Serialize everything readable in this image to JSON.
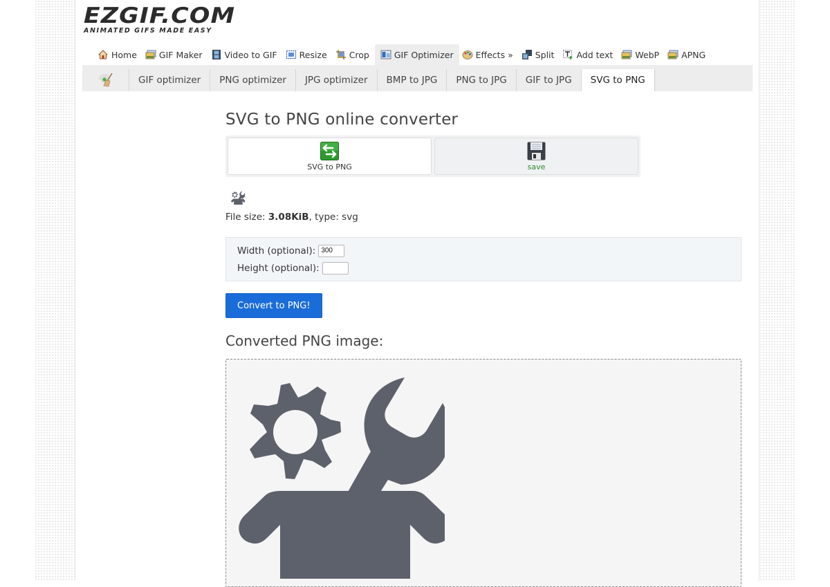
{
  "logo": {
    "main": "EZGIF.COM",
    "tagline": "ANIMATED GIFS MADE EASY"
  },
  "topnav": [
    {
      "label": "Home",
      "icon": "home-icon",
      "active": false
    },
    {
      "label": "GIF Maker",
      "icon": "picture-icon",
      "active": false
    },
    {
      "label": "Video to GIF",
      "icon": "film-icon",
      "active": false
    },
    {
      "label": "Resize",
      "icon": "resize-icon",
      "active": false
    },
    {
      "label": "Crop",
      "icon": "crop-icon",
      "active": false
    },
    {
      "label": "GIF Optimizer",
      "icon": "optimizer-icon",
      "active": true
    },
    {
      "label": "Effects »",
      "icon": "palette-icon",
      "active": false
    },
    {
      "label": "Split",
      "icon": "split-icon",
      "active": false
    },
    {
      "label": "Add text",
      "icon": "add-text-icon",
      "active": false
    },
    {
      "label": "WebP",
      "icon": "picture-icon",
      "active": false
    },
    {
      "label": "APNG",
      "icon": "picture-icon",
      "active": false
    }
  ],
  "subnav": {
    "icon": "broom-icon",
    "tabs": [
      {
        "label": "GIF optimizer",
        "active": false
      },
      {
        "label": "PNG optimizer",
        "active": false
      },
      {
        "label": "JPG optimizer",
        "active": false
      },
      {
        "label": "BMP to JPG",
        "active": false
      },
      {
        "label": "PNG to JPG",
        "active": false
      },
      {
        "label": "GIF to JPG",
        "active": false
      },
      {
        "label": "SVG to PNG",
        "active": true
      }
    ]
  },
  "main": {
    "title": "SVG to PNG online converter",
    "actions": [
      {
        "label": "SVG to PNG",
        "icon": "convert-arrows-icon"
      },
      {
        "label": "save",
        "icon": "save-icon"
      }
    ],
    "file_info": {
      "prefix": "File size: ",
      "size": "3.08KiB",
      "suffix": ", type: svg"
    },
    "options": {
      "width_label": "Width (optional):",
      "width_value": "300",
      "height_label": "Height (optional):",
      "height_value": ""
    },
    "convert_button": "Convert to PNG!",
    "output_heading": "Converted PNG image:"
  },
  "colors": {
    "primary_button": "#1a6dd9",
    "save_text": "#2a8a2a",
    "svg_fill": "#5d616b"
  }
}
